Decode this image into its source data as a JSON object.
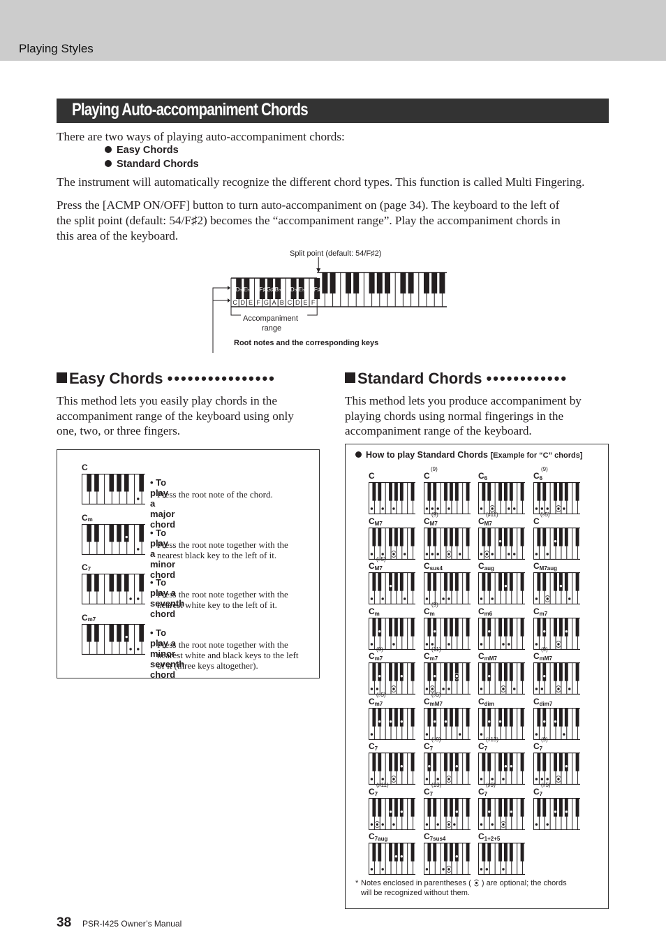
{
  "header": {
    "section": "Playing Styles"
  },
  "title": "Playing Auto-accompaniment Chords",
  "intro": "There are two ways of playing auto-accompaniment chords:",
  "ways": [
    "Easy Chords",
    "Standard Chords"
  ],
  "para_multi": "The instrument will automatically recognize the different chord types. This function is called Multi Fingering.",
  "para_acmp": [
    "Press the [ACMP ON/OFF] button to turn auto-accompaniment on (page 34). The keyboard to the left of",
    "the split point (default: 54/F♯2) becomes the “accompaniment range”. Play the accompaniment chords in",
    "this area of the keyboard."
  ],
  "split_diagram": {
    "split_label": "Split point (default: 54/F♯2)",
    "black_labels": [
      "D♭",
      "E♭",
      "F♯",
      "G♯",
      "B♭",
      "D♭",
      "E♭",
      "F♯"
    ],
    "white_labels": [
      "C",
      "D",
      "E",
      "F",
      "G",
      "A",
      "B",
      "C",
      "D",
      "E",
      "F"
    ],
    "range_label_1": "Accompaniment",
    "range_label_2": "range",
    "root_label": "Root notes and the corresponding keys"
  },
  "easy": {
    "heading": "Easy Chords",
    "body": [
      "This method lets you easily play chords in the",
      "accompaniment range of the keyboard using only",
      "one, two, or three fingers."
    ],
    "items": [
      {
        "name": "C",
        "sub": "",
        "notes": [
          12
        ],
        "head": "To play a major chord",
        "desc": [
          "Press the root note of the chord."
        ]
      },
      {
        "name": "C",
        "sub": "m",
        "notes": [
          10,
          12
        ],
        "head": "To play a minor chord",
        "desc": [
          "Press the root note together with the",
          "nearest black key to the left of it."
        ]
      },
      {
        "name": "C",
        "sub": "7",
        "notes": [
          11,
          12
        ],
        "head": "To play a seventh chord",
        "desc": [
          "Press the root note together with the",
          "nearest white key to the left of it."
        ]
      },
      {
        "name": "C",
        "sub": "m7",
        "notes": [
          10,
          11,
          12
        ],
        "head": "To play a minor seventh chord",
        "desc": [
          "Press the root note together with the",
          "nearest white and black keys to the left",
          "of it (three keys altogether)."
        ]
      }
    ]
  },
  "standard": {
    "heading": "Standard Chords",
    "body": [
      "This method lets you produce accompaniment by",
      "playing chords using normal fingerings in the",
      "accompaniment range of the keyboard."
    ],
    "box_title": "How to play Standard Chords",
    "box_example": "[Example for “C” chords]",
    "chords": [
      {
        "sub": "",
        "sup": "(9)",
        "label": "C",
        "notes": [
          0,
          4,
          7
        ],
        "optional": []
      },
      {
        "sub": "",
        "sup": "(9)",
        "label": "C(9)",
        "notes": [
          0,
          2,
          4,
          7
        ],
        "optional": []
      },
      {
        "sub": "6",
        "sup": "",
        "label": "C6",
        "notes": [
          0,
          9,
          11
        ],
        "optional": [
          4
        ]
      },
      {
        "sub": "6",
        "sup": "(9)",
        "label": "C6(9)",
        "notes": [
          0,
          2,
          4,
          9
        ],
        "optional": [
          7
        ]
      },
      {
        "sub": "M7",
        "sup": "",
        "label": "CM7",
        "notes": [
          0,
          4,
          11
        ],
        "optional": [
          7
        ]
      },
      {
        "sub": "M7",
        "sup": "(9)",
        "label": "CM7(9)",
        "notes": [
          0,
          2,
          4,
          11
        ],
        "optional": [
          7
        ]
      },
      {
        "sub": "M7",
        "sup": "(♯11)",
        "label": "CM7(#11)",
        "notes": [
          0,
          4,
          6,
          9,
          11
        ],
        "optional": [
          2
        ]
      },
      {
        "sub": "",
        "sup": "(♭5)",
        "label": "C(b5)",
        "notes": [
          0,
          4,
          6
        ],
        "optional": []
      },
      {
        "sub": "M7",
        "sup": "(♭5)",
        "label": "CM7(b5)",
        "notes": [
          0,
          4,
          6,
          11
        ],
        "optional": []
      },
      {
        "sub": "sus4",
        "sup": "",
        "label": "Csus4",
        "notes": [
          0,
          5,
          7
        ],
        "optional": []
      },
      {
        "sub": "aug",
        "sup": "",
        "label": "Caug",
        "notes": [
          0,
          4,
          8
        ],
        "optional": []
      },
      {
        "sub": "M7aug",
        "sup": "",
        "label": "CM7aug",
        "notes": [
          0,
          8,
          11
        ],
        "optional": [
          4
        ]
      },
      {
        "sub": "m",
        "sup": "",
        "label": "Cm",
        "notes": [
          0,
          3,
          7
        ],
        "optional": []
      },
      {
        "sub": "m",
        "sup": "(9)",
        "label": "Cm(9)",
        "notes": [
          0,
          2,
          3,
          7
        ],
        "optional": []
      },
      {
        "sub": "m6",
        "sup": "",
        "label": "Cm6",
        "notes": [
          0,
          3,
          7,
          9
        ],
        "optional": []
      },
      {
        "sub": "m7",
        "sup": "",
        "label": "Cm7",
        "notes": [
          0,
          3,
          10
        ],
        "optional": [
          7
        ]
      },
      {
        "sub": "m7",
        "sup": "(9)",
        "label": "Cm7(9)",
        "notes": [
          0,
          2,
          3,
          10
        ],
        "optional": [
          7
        ]
      },
      {
        "sub": "m7",
        "sup": "(11)",
        "label": "Cm7(11)",
        "notes": [
          0,
          3,
          5,
          7
        ],
        "optional": [
          2,
          10
        ]
      },
      {
        "sub": "mM7",
        "sup": "",
        "label": "CmM7",
        "notes": [
          0,
          3,
          11
        ],
        "optional": [
          7
        ]
      },
      {
        "sub": "mM7",
        "sup": "(9)",
        "label": "CmM7(9)",
        "notes": [
          0,
          2,
          3,
          11
        ],
        "optional": [
          7
        ]
      },
      {
        "sub": "m7",
        "sup": "(♭5)",
        "label": "Cm7(b5)",
        "notes": [
          0,
          3,
          6,
          10
        ],
        "optional": []
      },
      {
        "sub": "mM7",
        "sup": "(♭5)",
        "label": "CmM7(b5)",
        "notes": [
          0,
          3,
          6,
          11
        ],
        "optional": []
      },
      {
        "sub": "dim",
        "sup": "",
        "label": "Cdim",
        "notes": [
          0,
          3,
          6
        ],
        "optional": []
      },
      {
        "sub": "dim7",
        "sup": "",
        "label": "Cdim7",
        "notes": [
          0,
          3,
          6,
          9
        ],
        "optional": []
      },
      {
        "sub": "7",
        "sup": "",
        "label": "C7",
        "notes": [
          0,
          4,
          10
        ],
        "optional": [
          7
        ]
      },
      {
        "sub": "7",
        "sup": "(♭9)",
        "label": "C7(b9)",
        "notes": [
          1,
          0,
          4,
          10
        ],
        "optional": [
          7
        ]
      },
      {
        "sub": "7",
        "sup": "(♭13)",
        "label": "C7(b13)",
        "notes": [
          0,
          4,
          7,
          8,
          10
        ],
        "optional": []
      },
      {
        "sub": "7",
        "sup": "(9)",
        "label": "C7(9)",
        "notes": [
          0,
          2,
          4,
          10
        ],
        "optional": [
          7
        ]
      },
      {
        "sub": "7",
        "sup": "(♯11)",
        "label": "C7(#11)",
        "notes": [
          0,
          4,
          6,
          7,
          10
        ],
        "optional": [
          2
        ]
      },
      {
        "sub": "7",
        "sup": "(13)",
        "label": "C7(13)",
        "notes": [
          0,
          4,
          9,
          10
        ],
        "optional": [
          7
        ]
      },
      {
        "sub": "7",
        "sup": "(♯9)",
        "label": "C7(#9)",
        "notes": [
          0,
          3,
          4,
          10
        ],
        "optional": [
          7
        ]
      },
      {
        "sub": "7",
        "sup": "(♭5)",
        "label": "C7(b5)",
        "notes": [
          0,
          4,
          6,
          10
        ],
        "optional": []
      },
      {
        "sub": "7aug",
        "sup": "",
        "label": "C7aug",
        "notes": [
          0,
          4,
          8,
          10
        ],
        "optional": []
      },
      {
        "sub": "7sus4",
        "sup": "",
        "label": "C7sus4",
        "notes": [
          0,
          5,
          10
        ],
        "optional": [
          7
        ]
      },
      {
        "sub": "1+2+5",
        "sup": "",
        "label": "C1+2+5",
        "notes": [
          0,
          2,
          7
        ],
        "optional": []
      }
    ],
    "footnote_1": "Notes enclosed in parentheses (",
    "footnote_2": ") are optional; the chords",
    "footnote_3": "will be recognized without them.",
    "footnote_star": "*"
  },
  "footer": {
    "page": "38",
    "manual": "PSR-I425  Owner’s Manual"
  }
}
